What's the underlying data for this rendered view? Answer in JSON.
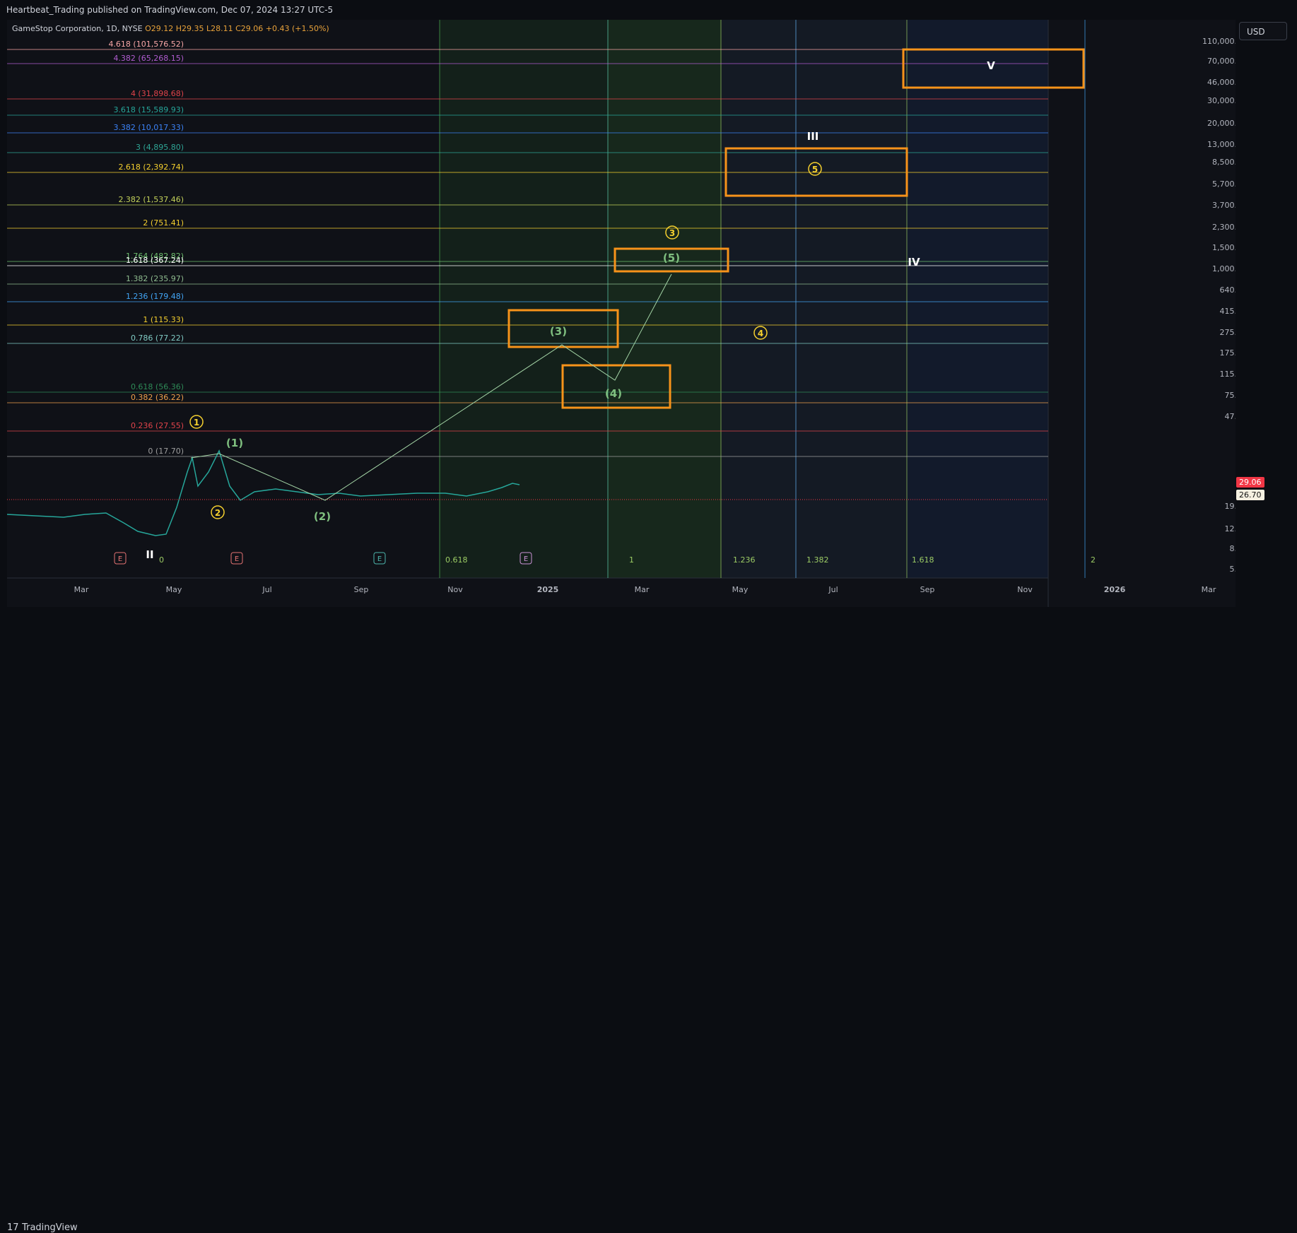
{
  "header": {
    "published": "Heartbeat_Trading published on TradingView.com, Dec 07, 2024 13:27 UTC-5",
    "symbol": "GameStop Corporation, 1D, NYSE",
    "ohlc": "O29.12  H29.35  L28.11  C29.06  +0.43 (+1.50%)",
    "currency": "USD"
  },
  "footer": {
    "logo_mark": "17",
    "logo_text": "TradingView"
  },
  "price_tags": {
    "last": "29.06",
    "avg": "26.70"
  },
  "colors": {
    "background": "#0f1117",
    "box_orange": "#f7931a",
    "wave_green": "#7fbf7f",
    "wave_yellow": "#f5d02e",
    "candle_up": "#26a69a",
    "candle_down": "#ef5350"
  },
  "chart_data": {
    "type": "line",
    "title": "",
    "x_axis_labels": [
      "Mar",
      "May",
      "Jul",
      "Sep",
      "Nov",
      "2025",
      "Mar",
      "May",
      "Jul",
      "Sep",
      "Nov",
      "2026",
      "Mar"
    ],
    "y_axis": {
      "scale": "log",
      "ticks": [
        "110,000.00",
        "70,000.00",
        "46,000.00",
        "30,000.00",
        "20,000.00",
        "13,000.00",
        "8,500.00",
        "5,700.00",
        "3,700.00",
        "2,300.00",
        "1,500.00",
        "1,000.00",
        "640.00",
        "415.00",
        "275.00",
        "175.00",
        "115.00",
        "75.00",
        "47.00",
        "29.06",
        "26.70",
        "19.00",
        "12.00",
        "8.00",
        "5.20"
      ]
    },
    "fib_levels": [
      {
        "label": "4.618 (101,576.52)",
        "color": "#f7a6a6"
      },
      {
        "label": "4.382 (65,268.15)",
        "color": "#b05ccf"
      },
      {
        "label": "4 (31,898.68)",
        "color": "#e0434a"
      },
      {
        "label": "3.618 (15,589.93)",
        "color": "#26a69a"
      },
      {
        "label": "3.382 (10,017.33)",
        "color": "#3b82f6"
      },
      {
        "label": "3 (4,895.80)",
        "color": "#2ea595"
      },
      {
        "label": "2.618 (2,392.74)",
        "color": "#f5d02e"
      },
      {
        "label": "2.382 (1,537.46)",
        "color": "#c4d35a"
      },
      {
        "label": "2 (751.41)",
        "color": "#f5d02e"
      },
      {
        "label": "1.764 (482.82)",
        "color": "#6dbe6d"
      },
      {
        "label": "1.618 (367.24)",
        "color": "#ffffff"
      },
      {
        "label": "1.382 (235.97)",
        "color": "#8fbc8f"
      },
      {
        "label": "1.236 (179.48)",
        "color": "#42a5f5"
      },
      {
        "label": "1 (115.33)",
        "color": "#f5d02e"
      },
      {
        "label": "0.786 (77.22)",
        "color": "#80cbc4"
      },
      {
        "label": "0.618 (56.36)",
        "color": "#2e8b57"
      },
      {
        "label": "0.382 (36.22)",
        "color": "#f0a04b"
      },
      {
        "label": "0.236 (27.55)",
        "color": "#e0434a"
      },
      {
        "label": "0 (17.70)",
        "color": "#9e9e9e"
      }
    ],
    "time_fib_labels": [
      "0",
      "0.618",
      "1",
      "1.236",
      "1.382",
      "1.618",
      "2"
    ],
    "wave_labels": [
      "(1)",
      "(2)",
      "(3)",
      "(4)",
      "(5)",
      "1",
      "2",
      "3",
      "4",
      "5",
      "II",
      "III",
      "IV",
      "V"
    ],
    "earnings_markers": [
      "E",
      "E",
      "E",
      "E"
    ]
  }
}
